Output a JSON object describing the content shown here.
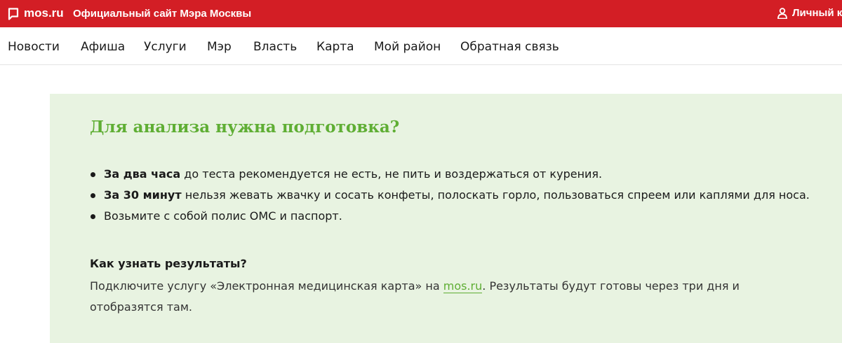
{
  "header": {
    "logo_text": "mos.ru",
    "site_title": "Официальный сайт Мэра Москвы",
    "account_label": "Личный к",
    "brand_color": "#d31e25",
    "logo_icon": "speech-bubble-icon",
    "account_icon": "user-icon"
  },
  "nav": {
    "items": [
      {
        "label": "Новости"
      },
      {
        "label": "Афиша"
      },
      {
        "label": "Услуги"
      },
      {
        "label": "Мэр"
      },
      {
        "label": "Власть"
      },
      {
        "label": "Карта"
      },
      {
        "label": "Мой район"
      },
      {
        "label": "Обратная связь"
      }
    ]
  },
  "panel": {
    "background": "#e8f3e1",
    "title_color": "#5fae34",
    "title": "Для анализа нужна подготовка?",
    "bullets": [
      {
        "bold": "За два часа",
        "text": " до теста рекомендуется не есть, не пить и воздержаться от курения."
      },
      {
        "bold": "За 30 минут",
        "text": " нельзя жевать жвачку и сосать конфеты, полоскать горло, пользоваться спреем или каплями для носа."
      },
      {
        "bold": "",
        "text": "Возьмите с собой полис ОМС и паспорт."
      }
    ],
    "results": {
      "heading": "Как узнать результаты?",
      "text_before": "Подключите услугу «Электронная медицинская карта» на ",
      "link_text": "mos.ru",
      "text_after": ". Результаты будут готовы через три дня и отобразятся там."
    }
  }
}
